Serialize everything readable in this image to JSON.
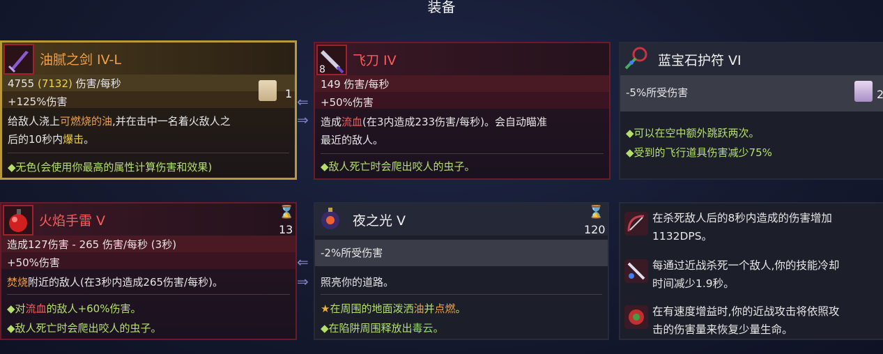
{
  "page_title": "装备",
  "cards": {
    "greasy_sword": {
      "name": "油腻之剑 IV-L",
      "stat_a": "4755",
      "stat_b": "(7132)",
      "stat_c": "伤害/每秒",
      "bonus": "+125%伤害",
      "desc_1a": "给敌人浇上",
      "desc_1b": "可燃烧的油",
      "desc_1c": ",并在击中一名着火敌人之",
      "desc_2a": "后的10秒内",
      "desc_2b": "爆击",
      "desc_2c": "。",
      "affix": "◆无色(会使用你最高的属性计算伤害和效果)",
      "scroll_count": "1"
    },
    "throwing_knife": {
      "name": "飞刀 IV",
      "icon_count": "8",
      "stat": "149 伤害/每秒",
      "bonus": "+50%伤害",
      "desc_1a": "造成",
      "desc_1b": "流血",
      "desc_1c": "(在3内造成233伤害/每秒)。会自动瞄准",
      "desc_2": "最近的敌人。",
      "affix": "◆敌人死亡时会爬出咬人的虫子。"
    },
    "sapphire_amulet": {
      "name": "蓝宝石护符 VI",
      "stat": "-5%所受伤害",
      "scroll_count": "2",
      "affix_1": "◆可以在空中额外跳跃两次。",
      "affix_2": "◆受到的飞行道具伤害减少75%"
    },
    "fire_grenade": {
      "name": "火焰手雷 V",
      "cooldown": "13",
      "stat": "造成127伤害 - 265 伤害/每秒 (3秒)",
      "bonus": "+50%伤害",
      "desc_1a": "焚烧",
      "desc_1b": "附近的敌人(在3秒内造成265伤害/每秒)。",
      "affix_1a": "◆对",
      "affix_1b": "流血",
      "affix_1c": "的敌人+60%伤害。",
      "affix_2": "◆敌人死亡时会爬出咬人的虫子。"
    },
    "night_light": {
      "name": "夜之光 V",
      "cooldown": "120",
      "stat": "-2%所受伤害",
      "desc": "照亮你的道路。",
      "affix_1a": "在周围的地面泼洒",
      "affix_1b": "油",
      "affix_1c": "并",
      "affix_1d": "点燃",
      "affix_1e": "。",
      "affix_2a": "◆在陷阱周围释放出",
      "affix_2b": "毒云",
      "affix_2c": "。"
    }
  },
  "mutations": [
    {
      "icon": "bow-mutation-icon",
      "line_1": "在杀死敌人后的8秒内造成的伤害增加",
      "line_2": "1132DPS。"
    },
    {
      "icon": "sword-mutation-icon",
      "line_1": "每通过近战杀死一个敌人,你的技能冷却",
      "line_2": "时间减少1.9秒。"
    },
    {
      "icon": "vampire-mutation-icon",
      "line_1": "在有速度增益时,你的近战攻击将依照攻",
      "line_2": "击的伤害量来恢复少量生命。"
    }
  ],
  "colors": {
    "accent_orange": "#f0a048",
    "accent_red": "#ff5a5a",
    "affix_green": "#b4e06a",
    "gold_border": "#b89a3a",
    "red_border": "#6b1a28"
  }
}
